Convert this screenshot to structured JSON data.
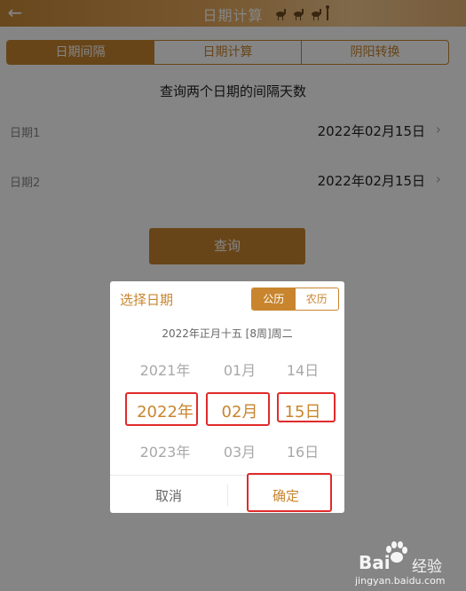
{
  "header": {
    "title": "日期计算"
  },
  "tabs": [
    {
      "label": "日期间隔",
      "active": true
    },
    {
      "label": "日期计算",
      "active": false
    },
    {
      "label": "阴阳转换",
      "active": false
    }
  ],
  "subtitle": "查询两个日期的间隔天数",
  "rows": [
    {
      "label": "日期1",
      "value": "2022年02月15日"
    },
    {
      "label": "日期2",
      "value": "2022年02月15日"
    }
  ],
  "query_label": "查询",
  "dialog": {
    "title": "选择日期",
    "calendar_types": [
      {
        "label": "公历",
        "active": true
      },
      {
        "label": "农历",
        "active": false
      }
    ],
    "summary": "2022年正月十五 [8周]周二",
    "year_column": [
      "2021年",
      "2022年",
      "2023年"
    ],
    "month_column": [
      "01月",
      "02月",
      "03月"
    ],
    "day_column": [
      "14日",
      "15日",
      "16日"
    ],
    "cancel_label": "取消",
    "confirm_label": "确定"
  },
  "watermark": {
    "brand": "Bai",
    "brand_suffix": "经验",
    "url": "jingyan.baidu.com"
  },
  "colors": {
    "accent": "#c8852e",
    "highlight": "#e12a2a"
  }
}
